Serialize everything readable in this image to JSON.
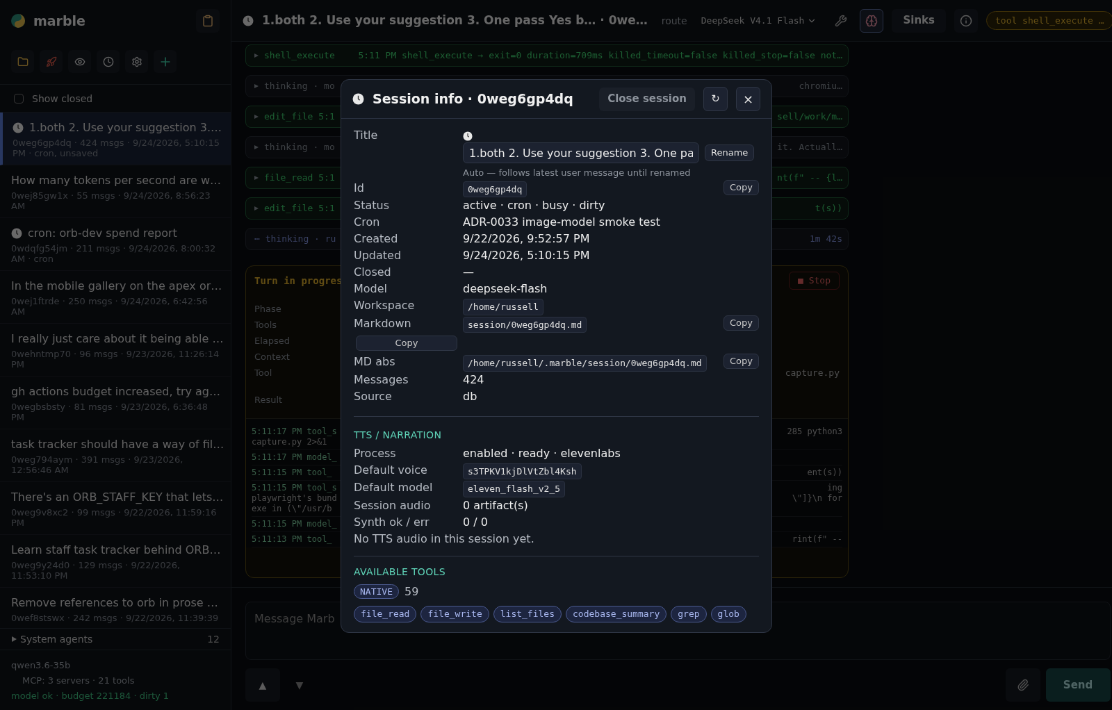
{
  "sidebar": {
    "app_name": "marble",
    "show_closed": {
      "label": "Show closed",
      "checked": false
    },
    "sessions": [
      {
        "title": "1.both 2. Use your suggestion 3.…",
        "meta": "0weg6gp4dq · 424 msgs · 9/24/2026, 5:10:15 PM · cron, unsaved",
        "cron": true,
        "selected": true
      },
      {
        "title": "How many tokens per second are w…",
        "meta": "0wej85gw1x · 55 msgs · 9/24/2026, 8:56:23 AM",
        "cron": false,
        "selected": false
      },
      {
        "title": "cron: orb-dev spend report",
        "meta": "0wdqfg54jm · 211 msgs · 9/24/2026, 8:00:32 AM · cron",
        "cron": true,
        "selected": false
      },
      {
        "title": "In the mobile gallery on the apex or…",
        "meta": "0wej1ftrde · 250 msgs · 9/24/2026, 6:42:56 AM",
        "cron": false,
        "selected": false
      },
      {
        "title": "I really just care about it being able …",
        "meta": "0wehntmp70 · 96 msgs · 9/23/2026, 11:26:14 PM",
        "cron": false,
        "selected": false
      },
      {
        "title": "gh actions budget increased, try ag…",
        "meta": "0wegbsbsty · 81 msgs · 9/23/2026, 6:36:48 PM",
        "cron": false,
        "selected": false
      },
      {
        "title": "task tracker should have a way of fil…",
        "meta": "0weg794aym · 391 msgs · 9/23/2026, 12:56:46 AM",
        "cron": false,
        "selected": false
      },
      {
        "title": "There's an ORB_STAFF_KEY that lets…",
        "meta": "0weg9v8xc2 · 99 msgs · 9/22/2026, 11:59:16 PM",
        "cron": false,
        "selected": false
      },
      {
        "title": "Learn staff task tracker behind ORB…",
        "meta": "0weg9y24d0 · 129 msgs · 9/22/2026, 11:53:10 PM",
        "cron": false,
        "selected": false
      },
      {
        "title": "Remove references to orb in prose …",
        "meta": "0wef8stswx · 242 msgs · 9/22/2026, 11:39:39",
        "cron": false,
        "selected": false
      }
    ],
    "system_agents": {
      "label": "System agents",
      "count": "12",
      "expanded": false
    },
    "footer": {
      "model": "qwen3.6-35b",
      "mcp": "MCP: 3 servers · 21 tools",
      "status": "model ok · budget 221184 · dirty 1"
    }
  },
  "topbar": {
    "title": "1.both 2. Use your suggestion 3. One pass Yes b… · 0we…",
    "route_label": "route",
    "model_select": "DeepSeek V4.1 Flash",
    "sinks": "Sinks",
    "tool_badge": "tool shell_execute …"
  },
  "log": [
    {
      "kind": "tool",
      "left": "shell_execute",
      "right": "5:11 PM shell_execute → exit=0 duration=709ms killed_timeout=false killed_stop=false not…"
    },
    {
      "kind": "thinking",
      "left": "thinking · mo",
      "right": "chromiu…"
    },
    {
      "kind": "tool",
      "left": "edit_file 5:1",
      "right": "sell/work/m…"
    },
    {
      "kind": "thinking",
      "left": "thinking · mo",
      "right": "it. Actuall…"
    },
    {
      "kind": "tool",
      "left": "file_read 5:1",
      "right": "nt(f\" -- {l…"
    },
    {
      "kind": "tool",
      "left": "edit_file 5:1",
      "right": "t(s))"
    },
    {
      "kind": "pending",
      "left": "⋯ thinking · ru",
      "right": "1m 42s"
    }
  ],
  "turn": {
    "title": "Turn in progres",
    "stop": "■ Stop",
    "labels": [
      "Phase",
      "Tools",
      "Elapsed",
      "Context",
      "Tool"
    ],
    "tool_value": "capture.py",
    "result_label": "Result",
    "lines": [
      {
        "left": "5:11:17 PM tool_s",
        "left2": "capture.py 2>&1",
        "right": "285 python3"
      },
      {
        "left": "5:11:17 PM model_"
      },
      {
        "left": "5:11:15 PM tool_",
        "right": "ent(s))"
      },
      {
        "left": "5:11:15 PM tool_s",
        "left2": "playwright's bund",
        "left3": "exe in (\\\"/usr/b",
        "right": "ing",
        "right2": "\\\"]}\\n for"
      },
      {
        "left": "5:11:15 PM model_"
      },
      {
        "left": "5:11:13 PM tool_",
        "right": "rint(f\" --"
      }
    ]
  },
  "composer": {
    "placeholder": "Message Marb",
    "up": "▲",
    "down": "▼",
    "send": "Send"
  },
  "modal": {
    "title": "Session info · 0weg6gp4dq",
    "close_session": "Close session",
    "refresh": "↻",
    "close": "×",
    "title_row": {
      "label": "Title",
      "value": "1.both 2. Use your suggestion 3. One pa",
      "rename": "Rename",
      "note": "Auto — follows latest user message until renamed"
    },
    "rows": [
      {
        "label": "Id",
        "kind": "code",
        "value": "0weg6gp4dq",
        "copy": "Copy"
      },
      {
        "label": "Status",
        "kind": "text",
        "value": "active · cron · busy · dirty"
      },
      {
        "label": "Cron",
        "kind": "text",
        "value": "ADR-0033 image-model smoke test"
      },
      {
        "label": "Created",
        "kind": "text",
        "value": "9/22/2026, 9:52:57 PM"
      },
      {
        "label": "Updated",
        "kind": "text",
        "value": "9/24/2026, 5:10:15 PM"
      },
      {
        "label": "Closed",
        "kind": "text",
        "value": "—"
      },
      {
        "label": "Model",
        "kind": "text",
        "value": "deepseek-flash"
      },
      {
        "label": "Workspace",
        "kind": "code",
        "value": "/home/russell"
      },
      {
        "label": "Markdown",
        "kind": "code",
        "value": "session/0weg6gp4dq.md",
        "copy": "Copy",
        "wide_button": "Copy"
      },
      {
        "label": "MD abs",
        "kind": "code",
        "value": "/home/russell/.marble/session/0weg6gp4dq.md",
        "copy": "Copy"
      },
      {
        "label": "Messages",
        "kind": "text",
        "value": "424"
      },
      {
        "label": "Source",
        "kind": "text",
        "value": "db"
      }
    ],
    "tts": {
      "heading": "TTS / NARRATION",
      "rows": [
        {
          "label": "Process",
          "kind": "text",
          "value": "enabled · ready · elevenlabs"
        },
        {
          "label": "Default voice",
          "kind": "code",
          "value": "s3TPKV1kjDlVtZbl4Ksh"
        },
        {
          "label": "Default model",
          "kind": "code",
          "value": "eleven_flash_v2_5"
        },
        {
          "label": "Session audio",
          "kind": "text",
          "value": "0 artifact(s)"
        },
        {
          "label": "Synth ok / err",
          "kind": "text",
          "value": "0 / 0"
        }
      ],
      "note": "No TTS audio in this session yet."
    },
    "tools": {
      "heading": "AVAILABLE TOOLS",
      "badge": "NATIVE",
      "count": "59",
      "chips": [
        "file_read",
        "file_write",
        "list_files",
        "codebase_summary",
        "grep",
        "glob"
      ]
    }
  }
}
